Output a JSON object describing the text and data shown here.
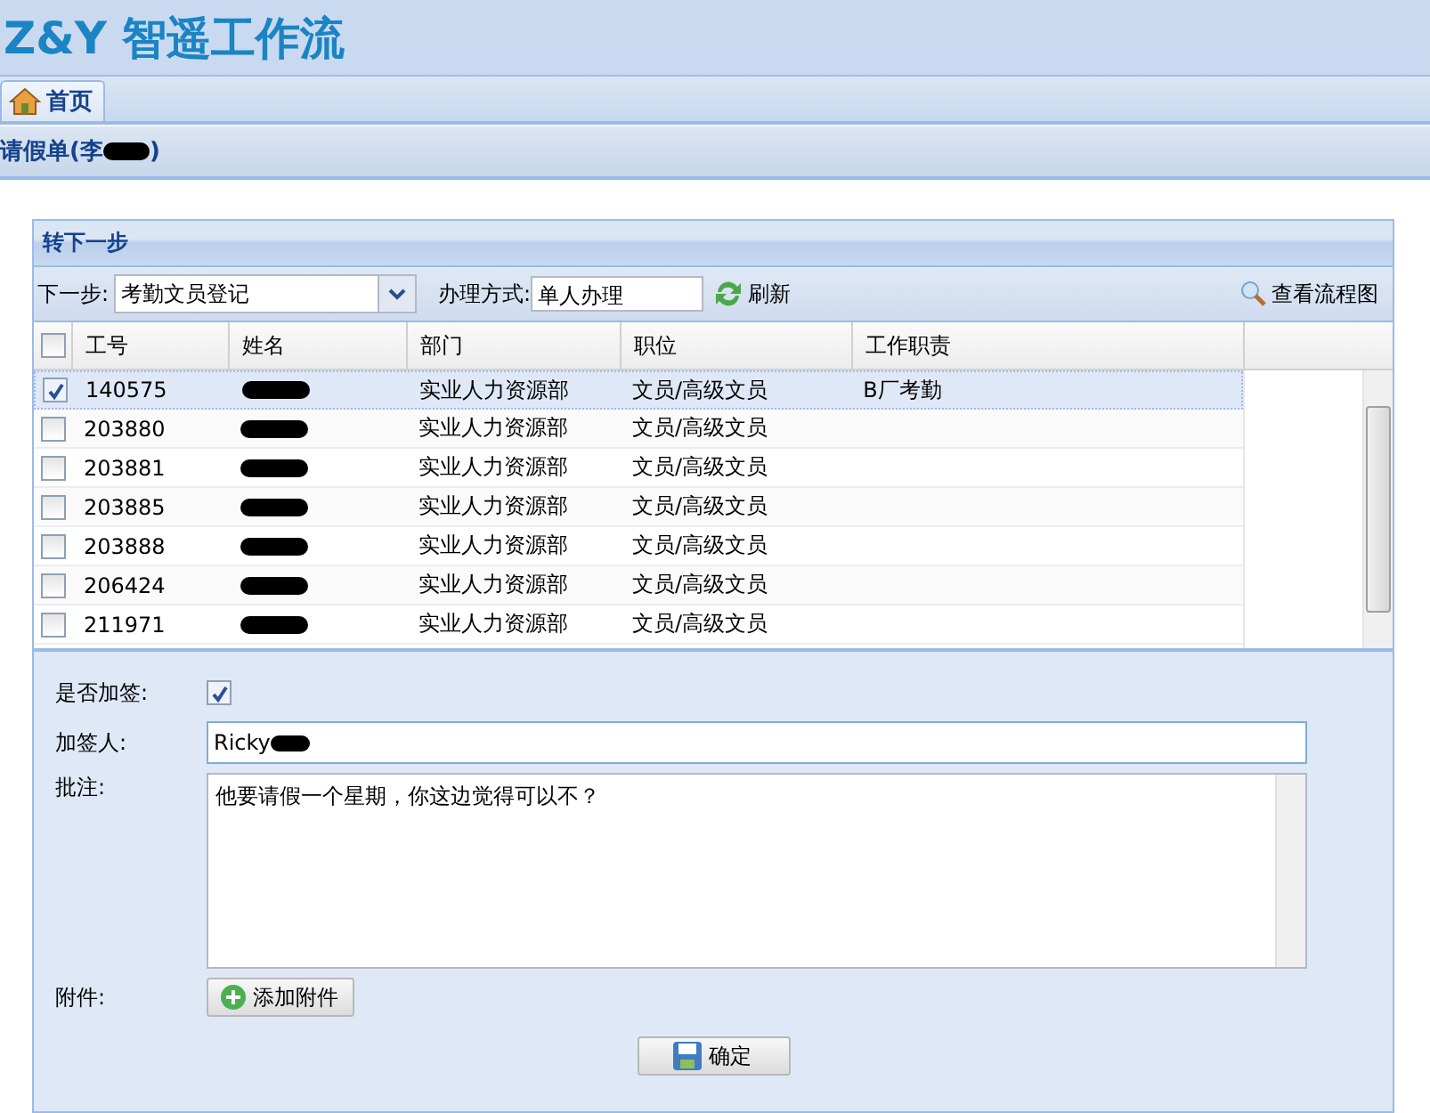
{
  "app": {
    "logo": "Z&Y 智遥工作流"
  },
  "tabs": [
    {
      "label": "首页",
      "selected": true
    }
  ],
  "form_title": {
    "prefix": "请假单(李",
    "redacted": true,
    "suffix": ")"
  },
  "panel": {
    "title": "转下一步",
    "toolbar": {
      "next_step_label": "下一步:",
      "next_step_value": "考勤文员登记",
      "mode_label": "办理方式:",
      "mode_value": "单人办理",
      "refresh": "刷新",
      "view_flow": "查看流程图"
    },
    "columns": [
      "工号",
      "姓名",
      "部门",
      "职位",
      "工作职责"
    ],
    "header_checked": false,
    "rows": [
      {
        "checked": true,
        "selected": true,
        "id": "140575",
        "name_redacted": true,
        "dept": "实业人力资源部",
        "position": "文员/高级文员",
        "duty": "B厂考勤"
      },
      {
        "checked": false,
        "selected": false,
        "id": "203880",
        "name_redacted": true,
        "dept": "实业人力资源部",
        "position": "文员/高级文员"
      },
      {
        "checked": false,
        "selected": false,
        "id": "203881",
        "name_redacted": true,
        "dept": "实业人力资源部",
        "position": "文员/高级文员"
      },
      {
        "checked": false,
        "selected": false,
        "id": "203885",
        "name_redacted": true,
        "dept": "实业人力资源部",
        "position": "文员/高级文员"
      },
      {
        "checked": false,
        "selected": false,
        "id": "203888",
        "name_redacted": true,
        "dept": "实业人力资源部",
        "position": "文员/高级文员"
      },
      {
        "checked": false,
        "selected": false,
        "id": "206424",
        "name_redacted": true,
        "dept": "实业人力资源部",
        "position": "文员/高级文员"
      },
      {
        "checked": false,
        "selected": false,
        "id": "211971",
        "name_redacted": true,
        "dept": "实业人力资源部",
        "position": "文员/高级文员"
      }
    ],
    "form": {
      "countersign_label": "是否加签:",
      "countersign_checked": true,
      "signer_label": "加签人:",
      "signer_value": "Ricky",
      "signer_redacted": true,
      "comment_label": "批注:",
      "comment_value": "他要请假一个星期，你这边觉得可以不？",
      "attach_label": "附件:",
      "attach_button": "添加附件",
      "confirm_button": "确定"
    }
  }
}
